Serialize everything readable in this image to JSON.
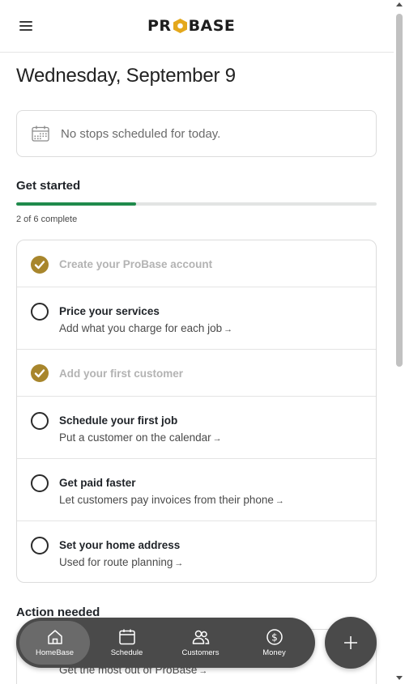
{
  "header": {
    "logo_left": "PR",
    "logo_right": "BASE"
  },
  "date_title": "Wednesday, September 9",
  "stops": {
    "message": "No stops scheduled for today."
  },
  "get_started": {
    "heading": "Get started",
    "progress_text": "2 of 6 complete",
    "progress_fraction": 0.333,
    "tasks": [
      {
        "title": "Create your ProBase account",
        "subtitle": "",
        "done": true
      },
      {
        "title": "Price your services",
        "subtitle": "Add what you charge for each job",
        "done": false
      },
      {
        "title": "Add your first customer",
        "subtitle": "",
        "done": true
      },
      {
        "title": "Schedule your first job",
        "subtitle": "Put a customer on the calendar",
        "done": false
      },
      {
        "title": "Get paid faster",
        "subtitle": "Let customers pay invoices from their phone",
        "done": false
      },
      {
        "title": "Set your home address",
        "subtitle": "Used for route planning",
        "done": false
      }
    ],
    "arrow": "→"
  },
  "action_needed": {
    "heading": "Action needed",
    "subtitle": "Get the most out of ProBase"
  },
  "bottom_nav": {
    "items": [
      {
        "label": "HomeBase",
        "icon": "home-icon"
      },
      {
        "label": "Schedule",
        "icon": "calendar-icon"
      },
      {
        "label": "Customers",
        "icon": "people-icon"
      },
      {
        "label": "Money",
        "icon": "dollar-icon"
      }
    ],
    "fab_icon": "plus-icon"
  },
  "colors": {
    "accent_gold": "#a8862c",
    "progress_green": "#1f8a4c",
    "nav_bg": "#4a4a4a"
  }
}
